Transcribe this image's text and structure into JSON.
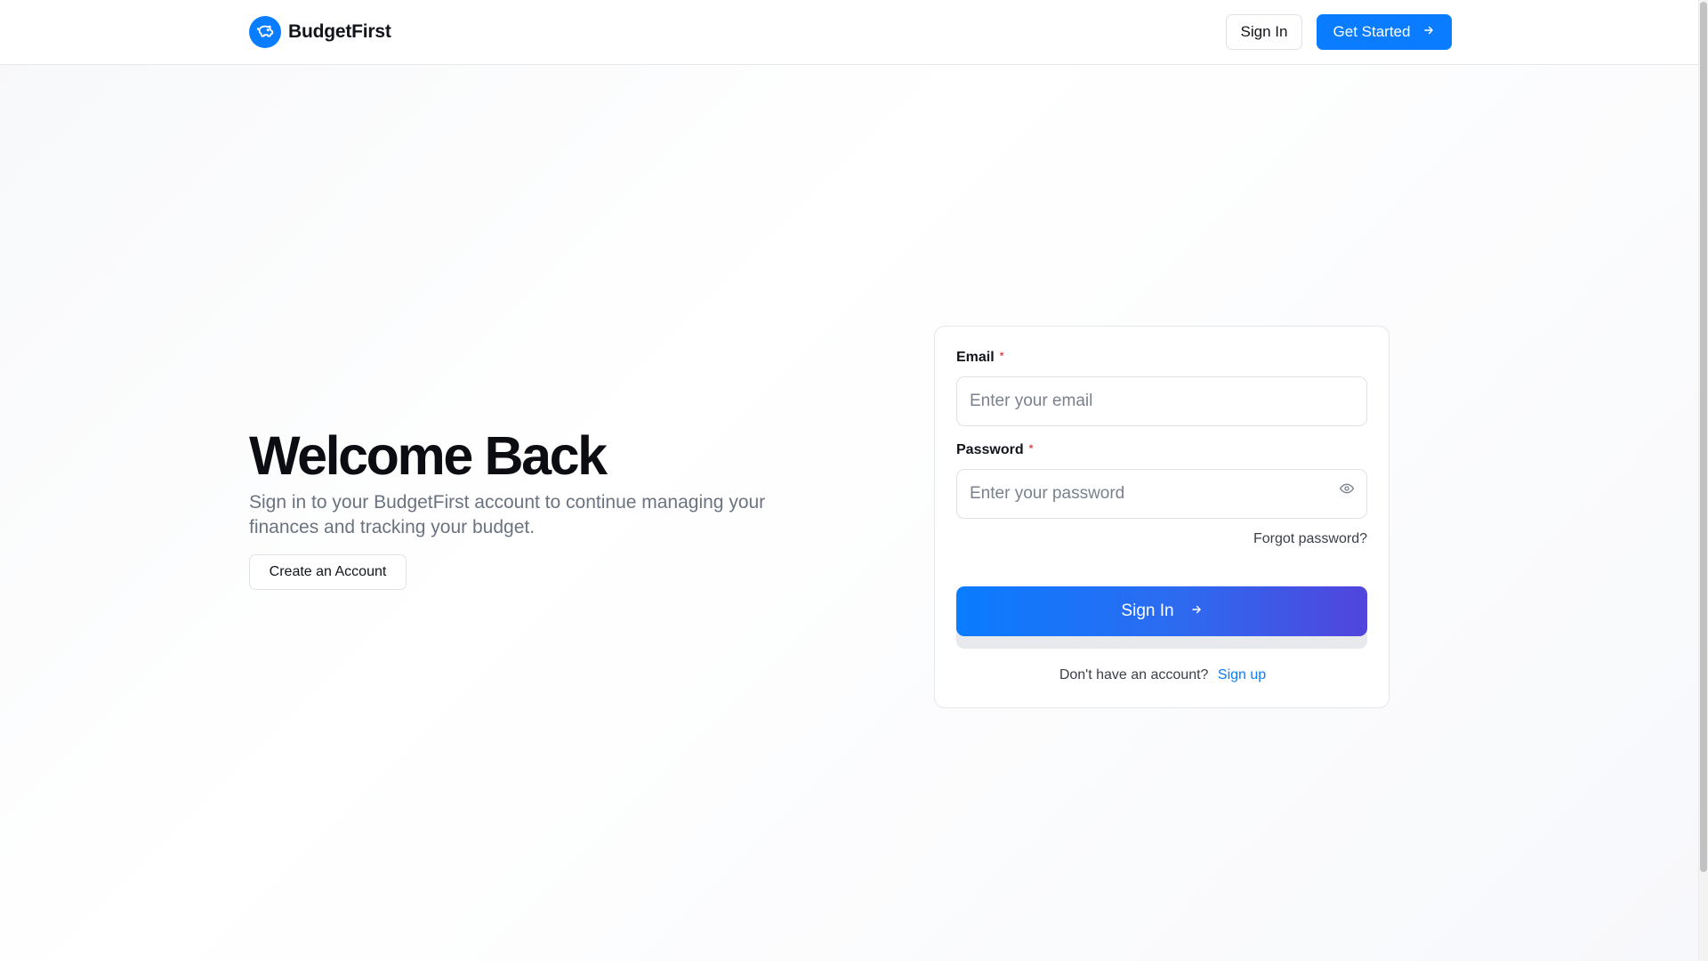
{
  "header": {
    "brand": "BudgetFirst",
    "brand_icon": "piggy-bank-icon",
    "sign_in_label": "Sign In",
    "get_started_label": "Get Started"
  },
  "hero": {
    "title": "Welcome Back",
    "subtitle": "Sign in to your BudgetFirst account to continue managing your finances and tracking your budget.",
    "create_account_label": "Create an Account"
  },
  "form": {
    "email_label": "Email",
    "email_required": "*",
    "email_placeholder": "Enter your email",
    "email_value": "",
    "password_label": "Password",
    "password_required": "*",
    "password_placeholder": "Enter your password",
    "password_value": "",
    "forgot_label": "Forgot password?",
    "submit_label": "Sign In",
    "signup_prompt": "Don't have an account?",
    "signup_link": "Sign up"
  },
  "colors": {
    "accent": "#0a7cff",
    "gradient_end": "#5145dc",
    "required": "#e5484d"
  }
}
